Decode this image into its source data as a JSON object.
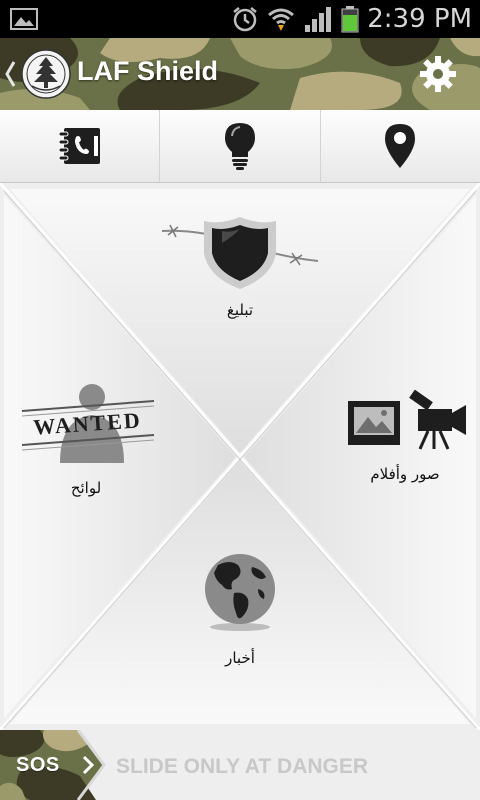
{
  "status_bar": {
    "time": "2:39 PM",
    "icons": [
      "image-notification-icon",
      "alarm-icon",
      "wifi-icon",
      "signal-icon",
      "battery-icon"
    ]
  },
  "app_bar": {
    "title": "LAF Shield",
    "icons": [
      "back-chevron-icon",
      "cedar-logo-icon",
      "gear-icon"
    ]
  },
  "toolbar": {
    "tabs": [
      {
        "name": "contacts",
        "icon": "phone-book-icon"
      },
      {
        "name": "tips",
        "icon": "lightbulb-icon"
      },
      {
        "name": "location",
        "icon": "map-pin-icon"
      }
    ]
  },
  "tiles": {
    "report": {
      "label": "تبليغ",
      "icon": "shield-barbed-wire-icon"
    },
    "wanted": {
      "label": "لوائح",
      "stamp": "WANTED",
      "icon": "wanted-person-icon"
    },
    "media": {
      "label": "صور وأفلام",
      "icon": "photo-video-camera-icon"
    },
    "news": {
      "label": "أخبار",
      "icon": "globe-icon"
    }
  },
  "sos": {
    "handle_label": "SOS",
    "slide_hint": "SLIDE ONLY AT DANGER"
  },
  "colors": {
    "camo_base": "#6a7047",
    "camo_dark": "#3d3b25",
    "camo_light": "#9a9a6a",
    "camo_tan": "#b5ab7e",
    "icon_dark": "#1e1e1e",
    "hint_text": "#c8c8c8"
  }
}
